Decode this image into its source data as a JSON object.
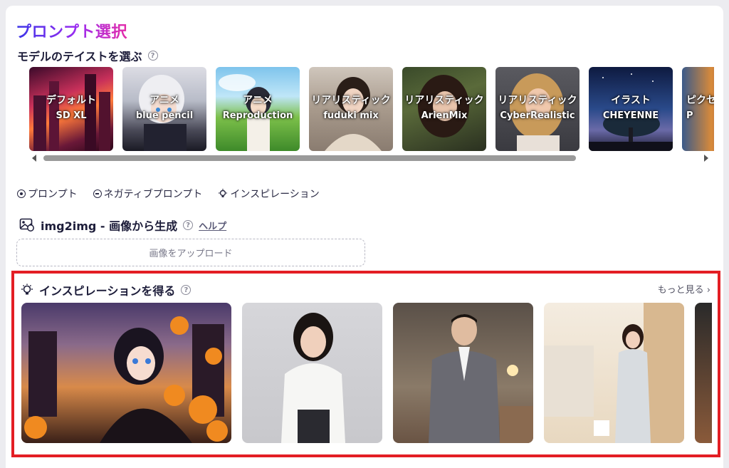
{
  "title": "プロンプト選択",
  "model_section": {
    "heading": "モデルのテイストを選ぶ",
    "help_icon": "question-circle-icon",
    "models": [
      {
        "category": "デフォルト",
        "name": "SD XL"
      },
      {
        "category": "アニメ",
        "name": "blue pencil"
      },
      {
        "category": "アニメ",
        "name": "Reproduction"
      },
      {
        "category": "リアリスティック",
        "name": "fuduki mix"
      },
      {
        "category": "リアリスティック",
        "name": "ArienMix"
      },
      {
        "category": "リアリスティック",
        "name": "CyberRealistic"
      },
      {
        "category": "イラスト",
        "name": "CHEYENNE"
      },
      {
        "category": "ピクセ",
        "name": "P"
      }
    ]
  },
  "tabs": [
    {
      "label": "プロンプト",
      "icon": "radio-dot-icon"
    },
    {
      "label": "ネガティブプロンプト",
      "icon": "minus-circle-icon"
    },
    {
      "label": "インスピレーション",
      "icon": "lightbulb-icon"
    }
  ],
  "img2img": {
    "heading": "img2img - 画像から生成",
    "help_link": "ヘルプ",
    "upload_label": "画像をアップロード"
  },
  "inspiration": {
    "heading": "インスピレーションを得る",
    "more_label": "もっと見る",
    "images": [
      "halloween-anime-girl",
      "woman-white-blouse",
      "man-grey-suit",
      "woman-clothing-store",
      "partial-image"
    ]
  },
  "colors": {
    "highlight": "#e31e24",
    "title_gradient_start": "#3a35e8",
    "title_gradient_end": "#e42ca8"
  }
}
